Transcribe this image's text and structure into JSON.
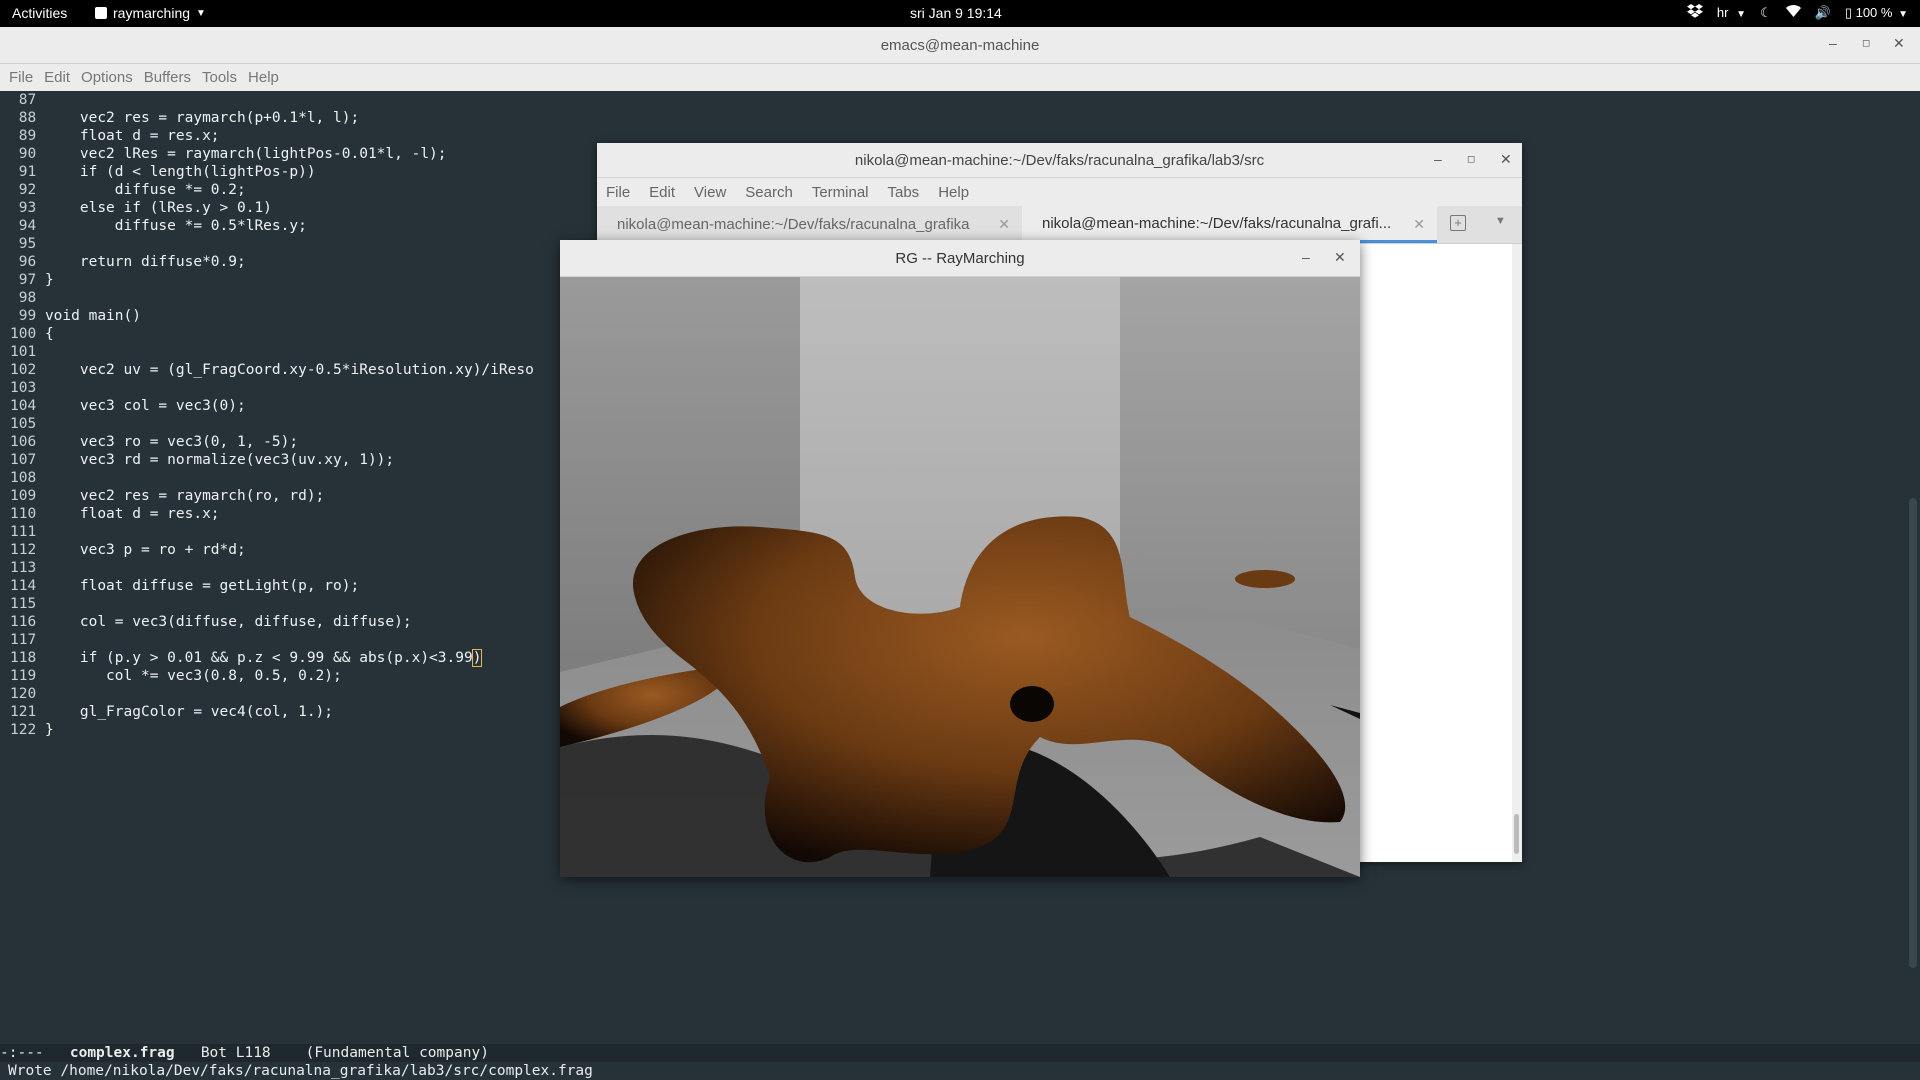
{
  "topbar": {
    "activities": "Activities",
    "app_name": "raymarching",
    "clock": "sri Jan 9  19:14",
    "keyboard_layout": "hr",
    "battery": "100 %"
  },
  "emacs": {
    "title": "emacs@mean-machine",
    "menu": [
      "File",
      "Edit",
      "Options",
      "Buffers",
      "Tools",
      "Help"
    ],
    "code_lines": [
      {
        "n": "87",
        "text": ""
      },
      {
        "n": "88",
        "text": "    vec2 res = raymarch(p+0.1*l, l);"
      },
      {
        "n": "89",
        "text": "    float d = res.x;"
      },
      {
        "n": "90",
        "text": "    vec2 lRes = raymarch(lightPos-0.01*l, -l);"
      },
      {
        "n": "91",
        "text": "    if (d < length(lightPos-p))"
      },
      {
        "n": "92",
        "text": "        diffuse *= 0.2;"
      },
      {
        "n": "93",
        "text": "    else if (lRes.y > 0.1)"
      },
      {
        "n": "94",
        "text": "        diffuse *= 0.5*lRes.y;"
      },
      {
        "n": "95",
        "text": ""
      },
      {
        "n": "96",
        "text": "    return diffuse*0.9;"
      },
      {
        "n": "97",
        "text": "}"
      },
      {
        "n": "98",
        "text": ""
      },
      {
        "n": "99",
        "text": "void main()"
      },
      {
        "n": "100",
        "text": "{"
      },
      {
        "n": "101",
        "text": ""
      },
      {
        "n": "102",
        "text": "    vec2 uv = (gl_FragCoord.xy-0.5*iResolution.xy)/iReso"
      },
      {
        "n": "103",
        "text": ""
      },
      {
        "n": "104",
        "text": "    vec3 col = vec3(0);"
      },
      {
        "n": "105",
        "text": ""
      },
      {
        "n": "106",
        "text": "    vec3 ro = vec3(0, 1, -5);"
      },
      {
        "n": "107",
        "text": "    vec3 rd = normalize(vec3(uv.xy, 1));"
      },
      {
        "n": "108",
        "text": ""
      },
      {
        "n": "109",
        "text": "    vec2 res = raymarch(ro, rd);"
      },
      {
        "n": "110",
        "text": "    float d = res.x;"
      },
      {
        "n": "111",
        "text": ""
      },
      {
        "n": "112",
        "text": "    vec3 p = ro + rd*d;"
      },
      {
        "n": "113",
        "text": ""
      },
      {
        "n": "114",
        "text": "    float diffuse = getLight(p, ro);"
      },
      {
        "n": "115",
        "text": ""
      },
      {
        "n": "116",
        "text": "    col = vec3(diffuse, diffuse, diffuse);"
      },
      {
        "n": "117",
        "text": ""
      },
      {
        "n": "118",
        "text": "    if (p.y > 0.01 && p.z < 9.99 && abs(p.x)<3.99)"
      },
      {
        "n": "119",
        "text": "       col *= vec3(0.8, 0.5, 0.2);"
      },
      {
        "n": "120",
        "text": ""
      },
      {
        "n": "121",
        "text": "    gl_FragColor = vec4(col, 1.);"
      },
      {
        "n": "122",
        "text": "}"
      }
    ],
    "modeline": {
      "status": "-:---",
      "buffer": "complex.frag",
      "position": "Bot L118",
      "mode": "(Fundamental company)"
    },
    "minibuffer": "Wrote /home/nikola/Dev/faks/racunalna_grafika/lab3/src/complex.frag"
  },
  "terminal": {
    "title": "nikola@mean-machine:~/Dev/faks/racunalna_grafika/lab3/src",
    "menu": [
      "File",
      "Edit",
      "View",
      "Search",
      "Terminal",
      "Tabs",
      "Help"
    ],
    "tabs": [
      {
        "label": "nikola@mean-machine:~/Dev/faks/racunalna_grafika",
        "active": false
      },
      {
        "label": "nikola@mean-machine:~/Dev/faks/racunalna_grafi...",
        "active": true
      }
    ]
  },
  "rg_window": {
    "title": "RG -- RayMarching",
    "object_color": "#8a4f1c"
  }
}
